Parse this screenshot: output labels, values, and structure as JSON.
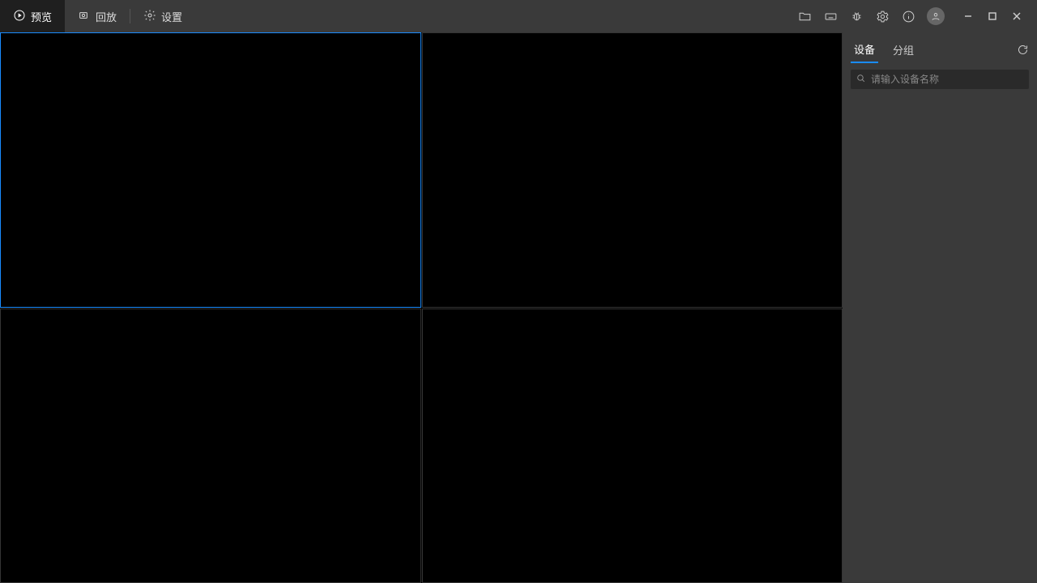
{
  "tabs": {
    "preview": "预览",
    "playback": "回放",
    "settings": "设置"
  },
  "sidepanel": {
    "tab_device": "设备",
    "tab_group": "分组",
    "search_placeholder": "请输入设备名称"
  },
  "icons": {
    "folder": "folder-icon",
    "keyboard": "keyboard-icon",
    "bug": "bug-icon",
    "gear": "gear-icon",
    "info": "info-icon",
    "avatar": "avatar-icon",
    "minimize": "minimize-icon",
    "maximize": "maximize-icon",
    "close": "close-icon",
    "refresh": "refresh-icon",
    "search": "search-icon",
    "play": "play-icon",
    "record": "record-icon",
    "settings_small": "settings-small-icon"
  }
}
